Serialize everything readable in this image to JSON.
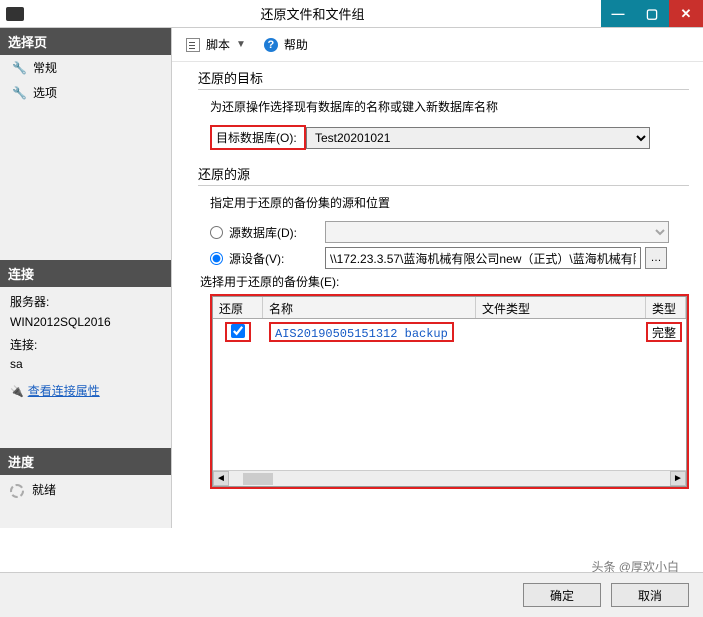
{
  "titlebar": {
    "title": "还原文件和文件组"
  },
  "left": {
    "select_page": "选择页",
    "items": [
      "常规",
      "选项"
    ],
    "connect_head": "连接",
    "server_label": "服务器:",
    "server_value": "WIN2012SQL2016",
    "conn_label": "连接:",
    "conn_value": "sa",
    "view_props": "查看连接属性",
    "progress_head": "进度",
    "status": "就绪"
  },
  "toolbar": {
    "script": "脚本",
    "help": "帮助"
  },
  "dest": {
    "title": "还原的目标",
    "desc": "为还原操作选择现有数据库的名称或键入新数据库名称",
    "db_label": "目标数据库(O):",
    "db_value": "Test20201021"
  },
  "source": {
    "title": "还原的源",
    "desc": "指定用于还原的备份集的源和位置",
    "radio_db": "源数据库(D):",
    "radio_dev": "源设备(V):",
    "device_path": "\\\\172.23.3.57\\蓝海机械有限公司new（正式）\\蓝海机械有限公",
    "sel_label": "选择用于还原的备份集(E):"
  },
  "grid": {
    "h1": "还原",
    "h2": "名称",
    "h3": "文件类型",
    "h4": "类型",
    "row": {
      "name": "AIS20190505151312 backup",
      "type": "完整"
    }
  },
  "footer": {
    "ok": "确定",
    "cancel": "取消"
  },
  "watermark": "头条 @厚欢小白"
}
